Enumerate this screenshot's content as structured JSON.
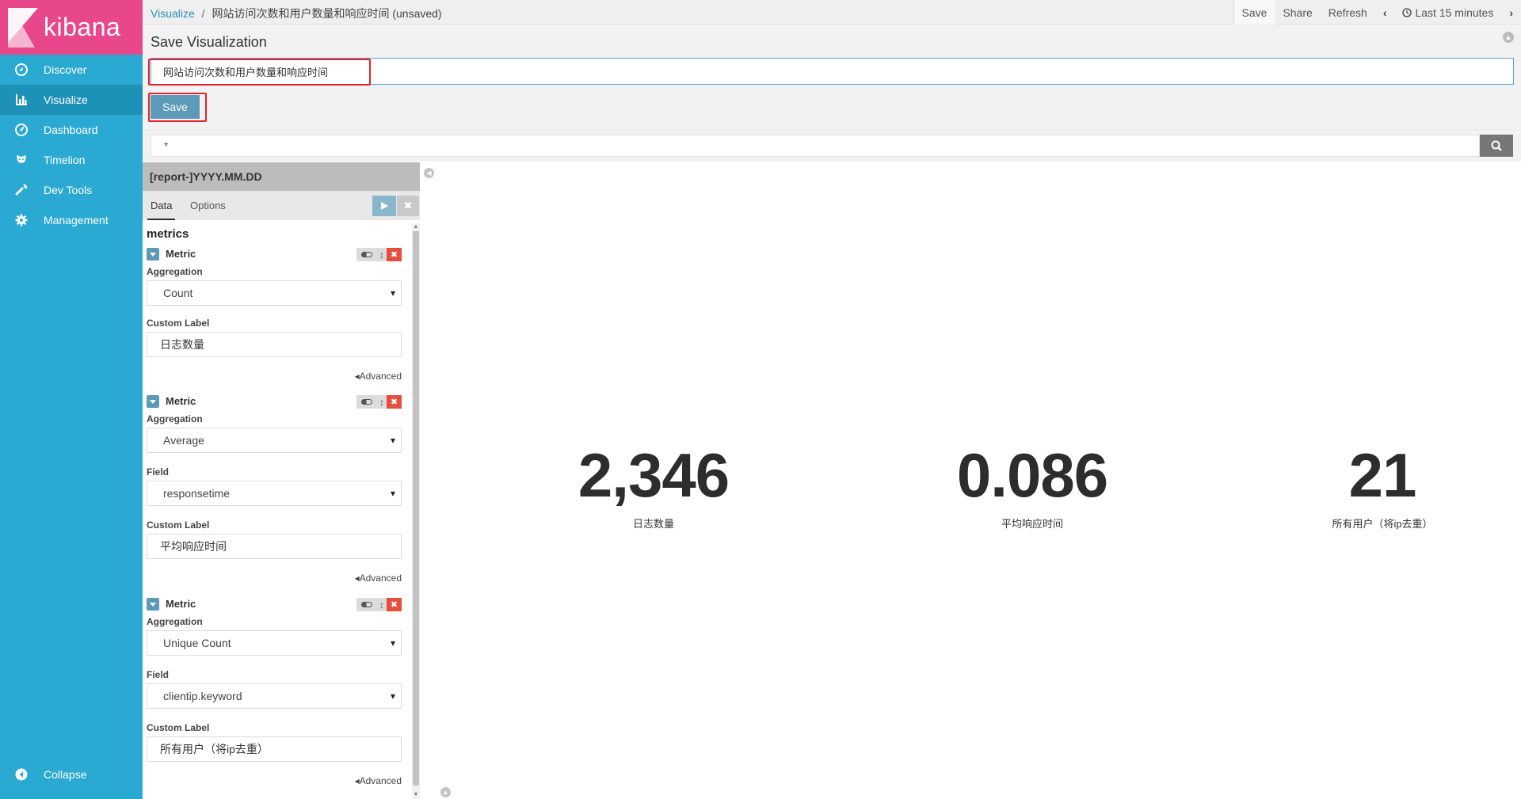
{
  "app": {
    "brand": "kibana"
  },
  "sidebar": {
    "items": [
      {
        "label": "Discover",
        "icon": "compass-icon"
      },
      {
        "label": "Visualize",
        "icon": "bar-chart-icon"
      },
      {
        "label": "Dashboard",
        "icon": "dashboard-icon"
      },
      {
        "label": "Timelion",
        "icon": "timelion-icon"
      },
      {
        "label": "Dev Tools",
        "icon": "wrench-icon"
      },
      {
        "label": "Management",
        "icon": "gear-icon"
      }
    ],
    "active": "Visualize",
    "collapse_label": "Collapse"
  },
  "topbar": {
    "breadcrumb_root": "Visualize",
    "breadcrumb_sep": "/",
    "breadcrumb_current": "网站访问次数和用户数量和响应时间 (unsaved)",
    "save": "Save",
    "share": "Share",
    "refresh": "Refresh",
    "time_range": "Last 15 minutes"
  },
  "save_panel": {
    "title": "Save Visualization",
    "input_value": "网站访问次数和用户数量和响应时间",
    "save_button": "Save"
  },
  "query": {
    "value": "*"
  },
  "editor": {
    "index_pattern": "[report-]YYYY.MM.DD",
    "tabs": [
      "Data",
      "Options"
    ],
    "section_title": "metrics",
    "metrics": [
      {
        "title": "Metric",
        "aggregation_label": "Aggregation",
        "aggregation": "Count",
        "custom_label_label": "Custom Label",
        "custom_label": "日志数量",
        "advanced": "Advanced"
      },
      {
        "title": "Metric",
        "aggregation_label": "Aggregation",
        "aggregation": "Average",
        "field_label": "Field",
        "field": "responsetime",
        "custom_label_label": "Custom Label",
        "custom_label": "平均响应时间",
        "advanced": "Advanced"
      },
      {
        "title": "Metric",
        "aggregation_label": "Aggregation",
        "aggregation": "Unique Count",
        "field_label": "Field",
        "field": "clientip.keyword",
        "custom_label_label": "Custom Label",
        "custom_label": "所有用户（将ip去重）",
        "advanced": "Advanced"
      }
    ]
  },
  "visualization": {
    "metrics": [
      {
        "value": "2,346",
        "label": "日志数量"
      },
      {
        "value": "0.086",
        "label": "平均响应时间"
      },
      {
        "value": "21",
        "label": "所有用户（将ip去重）"
      }
    ]
  },
  "colors": {
    "sidebar": "#2aa9d2",
    "brand": "#e8478b",
    "highlight_box": "#e0242a",
    "primary_button": "#5d9aba"
  }
}
